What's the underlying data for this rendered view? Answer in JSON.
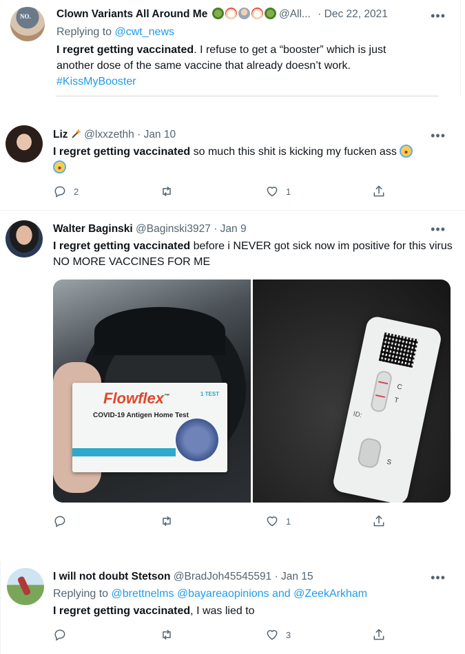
{
  "tweets": [
    {
      "display_name": "Clown Variants All Around Me",
      "name_emojis": [
        "virus-emoji",
        "clown-emoji",
        "scientist-emoji",
        "clown-emoji",
        "virus-emoji"
      ],
      "handle": "@All...",
      "dot": "·",
      "date": "Dec 22, 2021",
      "replying_prefix": "Replying to",
      "replying_to": "@cwt_news",
      "bold_text": "I regret getting vaccinated",
      "rest_text": ". I refuse to get a “booster” which is just another dose of the same vaccine that already doesn’t work.",
      "hashtag": "#KissMyBooster",
      "avatar_text": "NO."
    },
    {
      "display_name": "Liz",
      "handle": "@lxxzethh",
      "dot": "·",
      "date": "Jan 10",
      "bold_text": "I regret getting vaccinated",
      "rest_text": " so much this shit is kicking my fucken ass",
      "replies": "2",
      "retweets": "",
      "likes": "1"
    },
    {
      "display_name": "Walter Baginski",
      "handle": "@Baginski3927",
      "dot": "·",
      "date": "Jan 9",
      "bold_text": "I regret getting vaccinated",
      "rest_text": " before i NEVER got sick now im positive for this virus NO MORE VACCINES FOR ME",
      "replies": "",
      "retweets": "",
      "likes": "1",
      "box": {
        "brand": "Flowflex",
        "tm": "™",
        "badge": "1 TEST",
        "product": "COVID-19 Antigen Home Test"
      },
      "test": {
        "c": "C",
        "t": "T",
        "id": "ID:",
        "s": "S"
      }
    },
    {
      "display_name": "I will not doubt Stetson",
      "handle": "@BradJoh45545591",
      "dot": "·",
      "date": "Jan 15",
      "replying_prefix": "Replying to",
      "replying_to": "@brettnelms @bayareaopinions and @ZeekArkham",
      "bold_text": "I regret getting vaccinated",
      "rest_text": ", I was lied to",
      "replies": "",
      "retweets": "",
      "likes": "3"
    }
  ],
  "more_glyph": "•••",
  "colors": {
    "link": "#1d9bf0",
    "muted": "#536471",
    "text": "#0f1419",
    "divider": "#eff3f4"
  }
}
